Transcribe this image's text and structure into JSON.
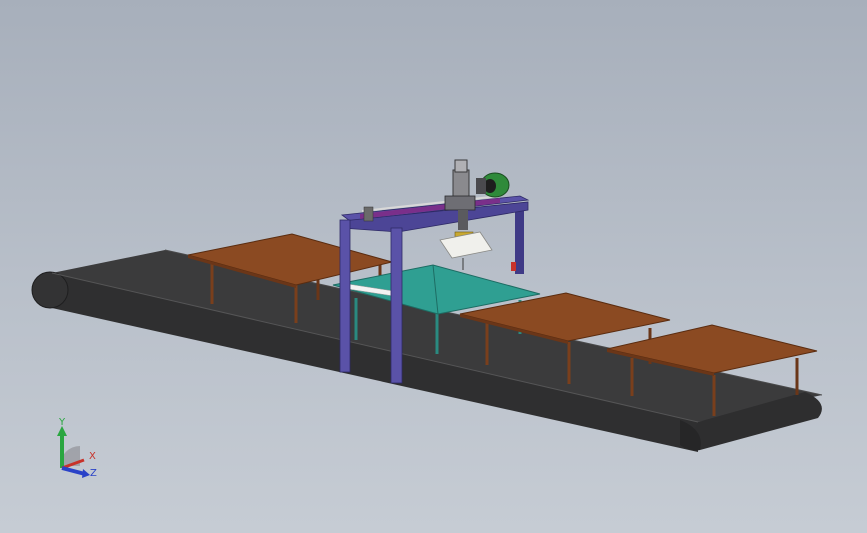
{
  "triad": {
    "y_label": "Y",
    "x_label": "X",
    "z_label": "Z"
  },
  "colors": {
    "viewport_top": "#a7afbb",
    "viewport_bottom": "#c6ccd4",
    "belt": "#3a3a3b",
    "belt_edge": "#2a2a2b",
    "table_top": "#8b4a22",
    "table_leg": "#7a3f1c",
    "frame": "#5a52a8",
    "frame_dark": "#3f3a86",
    "teal_table": "#2f9f92",
    "motor_green": "#2f8a3a",
    "axis_y": "#2aa640",
    "axis_x": "#c8322a",
    "axis_z": "#2a42c8"
  }
}
